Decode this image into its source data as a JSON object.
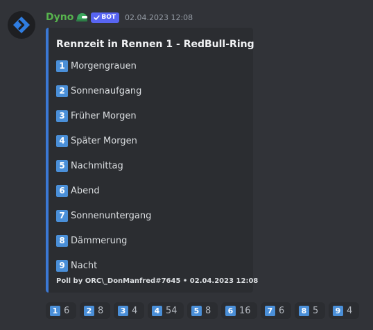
{
  "message": {
    "avatar_icon": "dyno-logo-icon",
    "author": "Dyno",
    "author_badge_icon": "helmet-icon",
    "bot_tag": "BOT",
    "timestamp": "02.04.2023 12:08"
  },
  "colors": {
    "background": "#313338",
    "embed_background": "#2b2d31",
    "embed_accent": "#3b78d4",
    "username": "#57b34d",
    "bot_tag": "#5865f2",
    "keycap": "#4a8fd8"
  },
  "embed": {
    "title": "Rennzeit in Rennen 1 - RedBull-Ring",
    "options": [
      {
        "key": "1",
        "label": "Morgengrauen"
      },
      {
        "key": "2",
        "label": "Sonnenaufgang"
      },
      {
        "key": "3",
        "label": "Früher Morgen"
      },
      {
        "key": "4",
        "label": "Später Morgen"
      },
      {
        "key": "5",
        "label": "Nachmittag"
      },
      {
        "key": "6",
        "label": "Abend"
      },
      {
        "key": "7",
        "label": "Sonnenuntergang"
      },
      {
        "key": "8",
        "label": "Dämmerung"
      },
      {
        "key": "9",
        "label": "Nacht"
      }
    ],
    "footer": "Poll by ORC\\_DonManfred#7645 • 02.04.2023 12:08"
  },
  "reactions": [
    {
      "key": "1",
      "count": "6"
    },
    {
      "key": "2",
      "count": "8"
    },
    {
      "key": "3",
      "count": "4"
    },
    {
      "key": "4",
      "count": "54"
    },
    {
      "key": "5",
      "count": "8"
    },
    {
      "key": "6",
      "count": "16"
    },
    {
      "key": "7",
      "count": "6"
    },
    {
      "key": "8",
      "count": "5"
    },
    {
      "key": "9",
      "count": "4"
    }
  ]
}
